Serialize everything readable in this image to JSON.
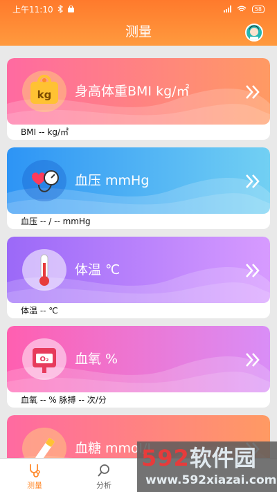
{
  "status": {
    "time": "上午11:10",
    "battery": "58"
  },
  "header": {
    "title": "测量"
  },
  "cards": [
    {
      "label": "身高体重BMI kg/㎡",
      "value": "BMI -- kg/㎡"
    },
    {
      "label": "血压 mmHg",
      "value": "血压 -- / -- mmHg"
    },
    {
      "label": "体温 ℃",
      "value": "体温 -- ℃"
    },
    {
      "label": "血氧 %",
      "value": "血氧 -- % 脉搏 -- 次/分"
    },
    {
      "label": "血糖 mmol/L",
      "value": ""
    }
  ],
  "tabs": [
    {
      "label": "测量"
    },
    {
      "label": "分析"
    }
  ],
  "watermark": {
    "logo_num": "592",
    "logo_text": "软件园",
    "url": "www.592xiazai.com"
  },
  "colors": {
    "accent": "#ff8a2d",
    "header": "#ff7a2c"
  },
  "icons": [
    "kg-icon",
    "blood-pressure-icon",
    "thermometer-icon",
    "oxygen-icon",
    "glucose-icon"
  ]
}
